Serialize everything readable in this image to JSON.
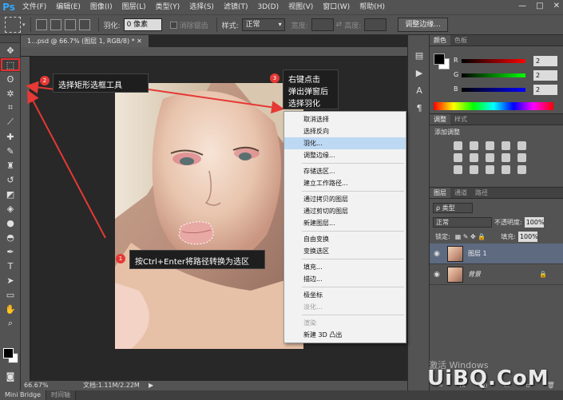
{
  "app": {
    "logo": "Ps",
    "menu": [
      "文件(F)",
      "编辑(E)",
      "图像(I)",
      "图层(L)",
      "类型(Y)",
      "选择(S)",
      "滤镜(T)",
      "3D(D)",
      "视图(V)",
      "窗口(W)",
      "帮助(H)"
    ],
    "window_controls": [
      "—",
      "□",
      "✕"
    ]
  },
  "options": {
    "feather_label": "羽化:",
    "feather_value": "0 像素",
    "antialias_label": "消除锯齿",
    "style_label": "样式:",
    "style_value": "正常",
    "width_label": "宽度:",
    "height_label": "高度:",
    "refine_button": "调整边缘..."
  },
  "document": {
    "tab_title": "1...psd @ 66.7% (图层 1, RGB/8) *  ✕"
  },
  "status": {
    "zoom": "66.67%",
    "doc_info": "文档:1.11M/2.22M",
    "arrow": "▶"
  },
  "bottom_tabs": [
    "Mini Bridge",
    "时间轴"
  ],
  "color_panel": {
    "tabs": [
      "颜色",
      "色板"
    ],
    "rows": [
      {
        "letter": "R",
        "value": "2",
        "gradient": "linear-gradient(to right,#000,#f00)"
      },
      {
        "letter": "G",
        "value": "2",
        "gradient": "linear-gradient(to right,#000,#0f0)"
      },
      {
        "letter": "B",
        "value": "2",
        "gradient": "linear-gradient(to right,#000,#00f)"
      }
    ]
  },
  "adjust_panel": {
    "tabs": [
      "调整",
      "样式"
    ],
    "title": "添加调整"
  },
  "layers_panel": {
    "tabs": [
      "图层",
      "通道",
      "路径"
    ],
    "filter": "ρ 类型",
    "blend_mode": "正常",
    "opacity_label": "不透明度:",
    "opacity_value": "100%",
    "lock_label": "锁定:",
    "fill_label": "填充:",
    "fill_value": "100%",
    "layers": [
      {
        "name": "图层 1",
        "selected": true
      },
      {
        "name": "背景",
        "selected": false
      }
    ],
    "bottom_icons": [
      "∞",
      "fx",
      "◐",
      "▭",
      "▫",
      "🗑"
    ]
  },
  "context_menu": {
    "items": [
      {
        "label": "取消选择",
        "state": "normal"
      },
      {
        "label": "选择反向",
        "state": "normal"
      },
      {
        "label": "羽化...",
        "state": "highlight"
      },
      {
        "label": "调整边缘...",
        "state": "normal"
      },
      {
        "label": "存储选区...",
        "state": "normal"
      },
      {
        "label": "建立工作路径...",
        "state": "normal"
      },
      {
        "label": "通过拷贝的图层",
        "state": "normal"
      },
      {
        "label": "通过剪切的图层",
        "state": "normal"
      },
      {
        "label": "新建图层...",
        "state": "normal"
      },
      {
        "label": "自由变换",
        "state": "normal"
      },
      {
        "label": "变换选区",
        "state": "normal"
      },
      {
        "label": "填充...",
        "state": "normal"
      },
      {
        "label": "描边...",
        "state": "normal"
      },
      {
        "label": "极坐标",
        "state": "normal"
      },
      {
        "label": "淡化...",
        "state": "disabled"
      },
      {
        "label": "渲染",
        "state": "disabled"
      },
      {
        "label": "新建 3D 凸出",
        "state": "normal"
      }
    ]
  },
  "annotations": {
    "step1": {
      "number": "1",
      "text": "按Ctrl+Enter将路径转换为选区"
    },
    "step2": {
      "number": "2",
      "text": "选择矩形选框工具"
    },
    "step3": {
      "number": "3",
      "lines": [
        "右键点击",
        "弹出弹窗后",
        "选择羽化"
      ]
    }
  },
  "watermark": {
    "activate": "激活 Windows",
    "site": "UiBQ.CoM"
  },
  "colors": {
    "annotation_red": "#e53935",
    "menu_highlight": "#bcd8f3",
    "selected_layer": "#5d6a80"
  }
}
